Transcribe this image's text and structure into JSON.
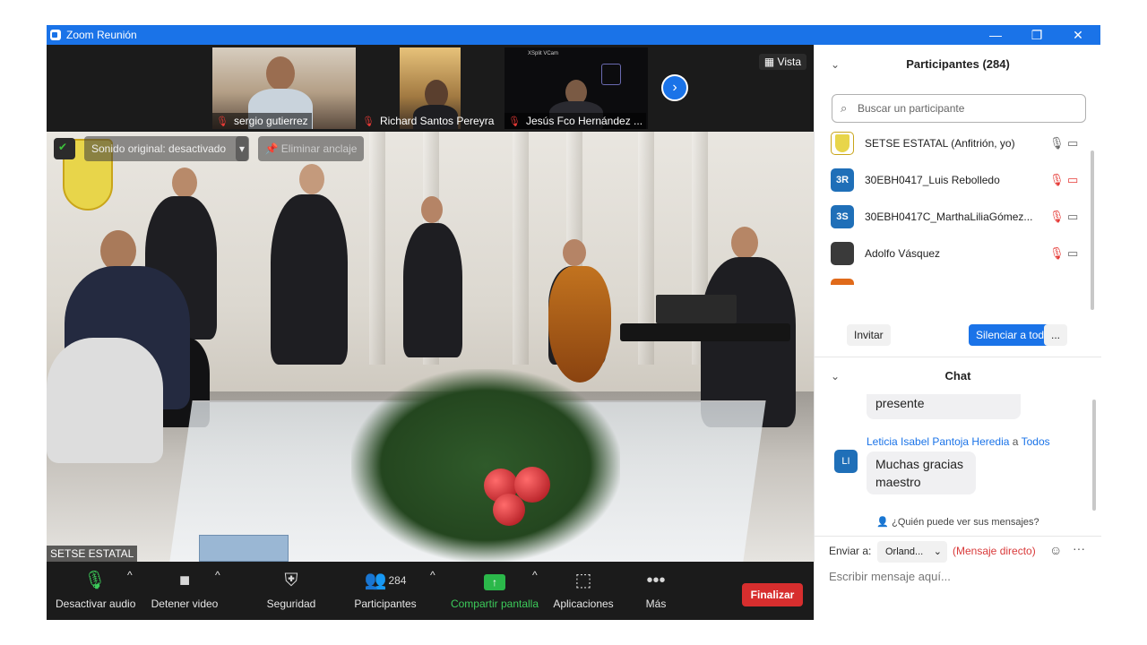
{
  "window": {
    "title": "Zoom Reunión",
    "controls": [
      "—",
      "❐",
      "✕"
    ]
  },
  "strip": {
    "participants": [
      {
        "name": "sergio gutierrez"
      },
      {
        "name": "Richard Santos Pereyra"
      },
      {
        "name": "Jesús Fco Hernández ..."
      }
    ],
    "cam_text": "XSplit VCam",
    "vista_label": "Vista"
  },
  "main_video": {
    "audio_label": "Sonido original: desactivado",
    "unpin_label": "Eliminar anclaje",
    "name_tag": "SETSE ESTATAL"
  },
  "toolbar": {
    "mute_label": "Desactivar audio",
    "video_label": "Detener video",
    "security_label": "Seguridad",
    "participants_label": "Participantes",
    "participants_count": "284",
    "share_label": "Compartir pantalla",
    "apps_label": "Aplicaciones",
    "more_label": "Más",
    "end_label": "Finalizar"
  },
  "participants_panel": {
    "title": "Participantes (284)",
    "search_placeholder": "Buscar un participante",
    "list": [
      {
        "initials": "",
        "name": "SETSE ESTATAL (Anfitrión, yo)",
        "color": "#ffffff"
      },
      {
        "initials": "3R",
        "name": "30EBH0417_Luis Rebolledo",
        "color": "#1f6fb8"
      },
      {
        "initials": "3S",
        "name": "30EBH0417C_MarthaLiliaGómez...",
        "color": "#1f6fb8"
      },
      {
        "initials": "",
        "name": "Adolfo Vásquez",
        "color": "#3a3a3a"
      }
    ],
    "invite_label": "Invitar",
    "mute_all_label": "Silenciar a todos",
    "more_label": "..."
  },
  "chat": {
    "title": "Chat",
    "prev_message": "presente",
    "sender": "Leticia Isabel Pantoja Heredia",
    "to_word": "a",
    "recipient": "Todos",
    "sender_initials": "LI",
    "message_line1": "Muchas gracias",
    "message_line2": "maestro",
    "who_can_see": "¿Quién puede ver sus mensajes?",
    "send_to_label": "Enviar a:",
    "send_to_value": "Orland...",
    "direct_label": "(Mensaje directo)",
    "input_placeholder": "Escribir mensaje aquí..."
  },
  "colors": {
    "accent": "#1a73e8",
    "end_red": "#d72e2e",
    "share_green": "#2bb84a",
    "muted_red": "#e53935"
  }
}
